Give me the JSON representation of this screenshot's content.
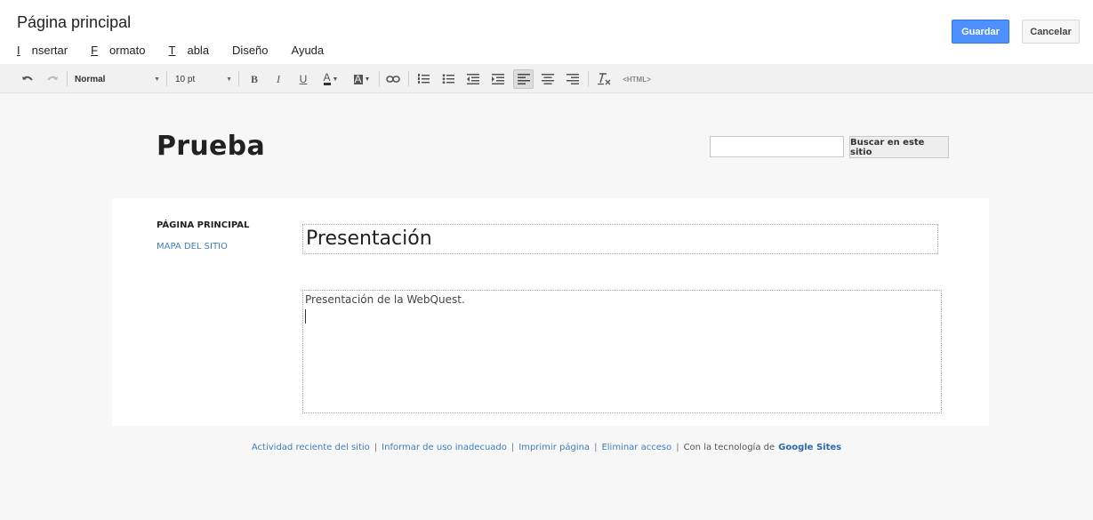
{
  "header": {
    "title": "Página principal",
    "menu": [
      {
        "label": "Insertar",
        "ul": "I",
        "rest": "nsertar"
      },
      {
        "label": "Formato",
        "ul": "F",
        "rest": "ormato"
      },
      {
        "label": "Tabla",
        "ul": "T",
        "rest": "abla"
      },
      {
        "label": "Diseño",
        "ul": "",
        "rest": "Diseño"
      },
      {
        "label": "Ayuda",
        "ul": "",
        "rest": "Ayuda"
      }
    ],
    "save_label": "Guardar",
    "cancel_label": "Cancelar",
    "save_color": "#4d90fe"
  },
  "toolbar": {
    "style_value": "Normal",
    "size_value": "10 pt",
    "bold": "B",
    "italic": "I",
    "underline": "U",
    "text_color": "A",
    "bg_color": "A",
    "html_label": "<HTML>"
  },
  "site": {
    "title": "Prueba",
    "search_placeholder": "",
    "search_button": "Buscar en este sitio",
    "nav": {
      "home": "PÁGINA PRINCIPAL",
      "sitemap": "MAPA DEL SITIO"
    },
    "page_heading": "Presentación",
    "page_body": "Presentación de la WebQuest."
  },
  "footer": {
    "links": [
      "Actividad reciente del sitio",
      "Informar de uso inadecuado",
      "Imprimir página",
      "Eliminar acceso"
    ],
    "powered_prefix": "Con la tecnología de",
    "powered_brand": "Google Sites",
    "link_color": "#3d7fc2"
  }
}
